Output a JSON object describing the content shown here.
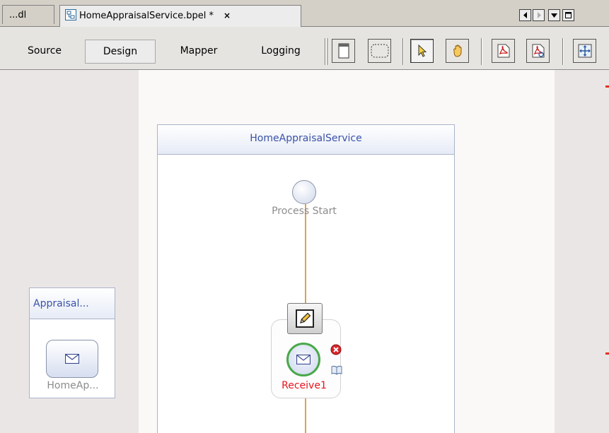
{
  "tabs": {
    "previous_tab_label": "...dl",
    "active_tab_label": "HomeAppraisalService.bpel *",
    "close_glyph": "×"
  },
  "views": {
    "source_label": "Source",
    "design_label": "Design",
    "mapper_label": "Mapper",
    "logging_label": "Logging",
    "active_view": "Design"
  },
  "toolbar_icons": [
    "show-partner-links-icon",
    "marquee-select-icon",
    "select-pointer-icon",
    "hand-pan-icon",
    "print-pdf-icon",
    "export-pdf-icon",
    "fit-diagram-icon"
  ],
  "process": {
    "name": "HomeAppraisalService",
    "start_label": "Process Start",
    "receive_label": "Receive1"
  },
  "partner_link": {
    "title": "Appraisal...",
    "operation_label": "HomeAp..."
  },
  "colors": {
    "process_title": "#3a52a8",
    "flow_line": "#e0a050",
    "receive_error_label": "#e8141e",
    "receive_ring": "#4aa84a"
  }
}
